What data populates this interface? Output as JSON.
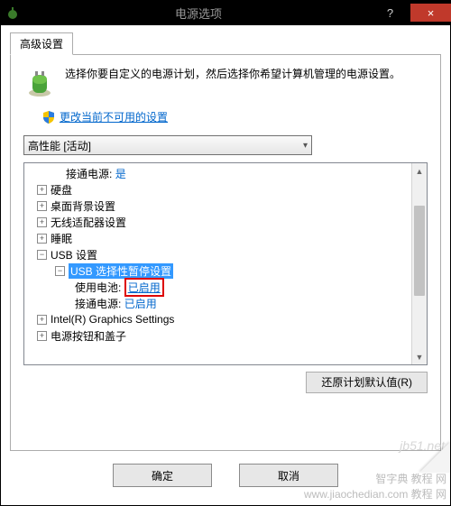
{
  "window": {
    "title": "电源选项",
    "help_label": "?",
    "close_label": "×"
  },
  "tab": {
    "advanced": "高级设置"
  },
  "intro": {
    "text": "选择你要自定义的电源计划，然后选择你希望计算机管理的电源设置。"
  },
  "admin_link": "更改当前不可用的设置",
  "plan_dropdown": {
    "value": "高性能 [活动]"
  },
  "tree": {
    "ac_label": "接通电源:",
    "ac_value": "是",
    "items": {
      "hdd": "硬盘",
      "desktop_bg": "桌面背景设置",
      "wifi": "无线适配器设置",
      "sleep": "睡眠",
      "usb": "USB 设置",
      "usb_suspend": "USB 选择性暂停设置",
      "battery_label": "使用电池:",
      "battery_value": "已启用",
      "ac2_label": "接通电源:",
      "ac2_value": "已启用",
      "intel": "Intel(R) Graphics Settings",
      "powerbtn": "电源按钮和盖子"
    }
  },
  "buttons": {
    "restore": "还原计划默认值(R)",
    "ok": "确定",
    "cancel": "取消"
  },
  "watermark1": "jb51.net",
  "watermark2": "智字典 教程 网",
  "watermark3": "www.jiaochedian.com  教程 网"
}
